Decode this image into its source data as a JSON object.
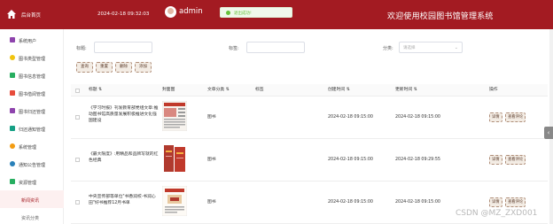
{
  "header": {
    "home_label": "后台首页",
    "datetime": "2024-02-18 09:32:03",
    "username": "admin",
    "system_title": "欢迎使用校园图书馆管理系统",
    "toast": "退出成功!"
  },
  "sidebar": {
    "items": [
      {
        "label": "系统用户",
        "icon_color": "#8e44ad"
      },
      {
        "label": "图书类型管理",
        "icon_color": "#f1c40f"
      },
      {
        "label": "图书信息管理",
        "icon_color": "#27ae60"
      },
      {
        "label": "图书借阅管理",
        "icon_color": "#e74c3c"
      },
      {
        "label": "图书归还管理",
        "icon_color": "#8e44ad"
      },
      {
        "label": "归还通知管理",
        "icon_color": "#16a085"
      },
      {
        "label": "系统管理",
        "icon_color": "#f39c12"
      },
      {
        "label": "通知公告管理",
        "icon_color": "#2980b9"
      },
      {
        "label": "资源管理",
        "icon_color": "#27ae60"
      }
    ],
    "sub_items": [
      "新闻资讯",
      "资讯分类"
    ]
  },
  "search": {
    "title_label": "标题:",
    "tag_label": "标签:",
    "category_label": "分类:",
    "category_placeholder": "请选择"
  },
  "toolbar": {
    "query": "查询",
    "reset": "重置",
    "delete": "删除",
    "add": "添加"
  },
  "table": {
    "headers": [
      "标题",
      "封面图",
      "文章分类",
      "标签",
      "创建时间",
      "更新时间",
      "操作"
    ],
    "rows": [
      {
        "title": "《学习时报》刊发教育部党组文章:推动图书馆高质量发展积极推进文化强国建设",
        "category": "图书",
        "tag": "",
        "created": "2024-02-18 09:15:00",
        "updated": "2024-02-18 09:15:00",
        "cover": "newspaper"
      },
      {
        "title": "《最大限度》:用精品和品牌写就的红色经典",
        "category": "图书",
        "tag": "",
        "created": "2024-02-18 09:15:00",
        "updated": "2024-02-18 09:29:55",
        "cover": "red-books"
      },
      {
        "title": "中央宣传部等单位\"书香润校·书润心田\"好书推荐12月书单",
        "category": "图书",
        "tag": "",
        "created": "2024-02-18 09:15:00",
        "updated": "2024-02-18 09:15:00",
        "cover": "poster"
      }
    ],
    "detail_label": "详情",
    "comment_label": "查看评论"
  },
  "watermark": "CSDN @MZ_ZXD001"
}
